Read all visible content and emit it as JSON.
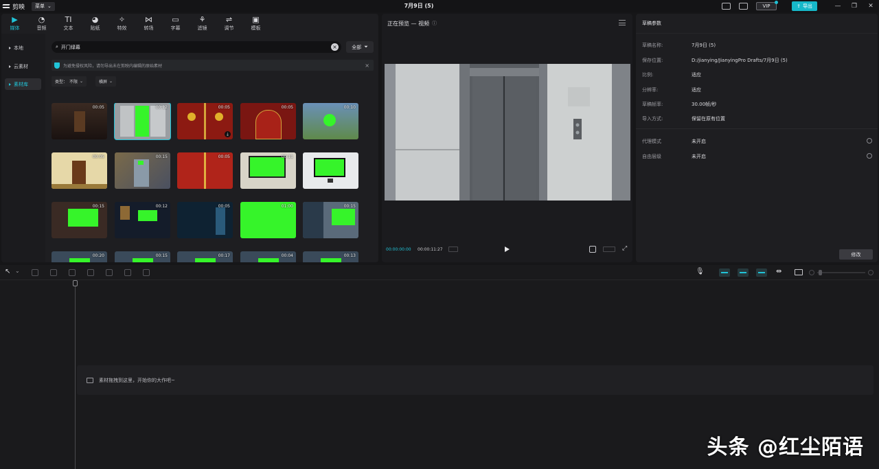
{
  "app": {
    "name": "剪映",
    "menu_label": "菜单",
    "title": "7月9日 (5)",
    "vip_label": "VIP",
    "export_label": "导出",
    "window_controls": [
      "minimize-icon",
      "restore-icon",
      "close-icon"
    ]
  },
  "toolbar": {
    "items": [
      {
        "label": "媒体",
        "icon": "media-icon",
        "active": true
      },
      {
        "label": "音频",
        "icon": "audio-icon"
      },
      {
        "label": "文本",
        "icon": "text-icon"
      },
      {
        "label": "贴纸",
        "icon": "sticker-icon"
      },
      {
        "label": "特效",
        "icon": "effect-icon"
      },
      {
        "label": "转场",
        "icon": "transition-icon"
      },
      {
        "label": "字幕",
        "icon": "subtitle-icon"
      },
      {
        "label": "滤镜",
        "icon": "filter-icon"
      },
      {
        "label": "调节",
        "icon": "adjust-icon"
      },
      {
        "label": "模板",
        "icon": "template-icon"
      }
    ]
  },
  "sidebar": {
    "items": [
      {
        "label": "本地"
      },
      {
        "label": "云素材"
      },
      {
        "label": "素材库",
        "active": true
      }
    ]
  },
  "search": {
    "value": "开门绿幕",
    "filter_label": "全部"
  },
  "notice": {
    "text": "为避免侵权风险，请勿导出未在剪映内编辑的原始素材"
  },
  "filters": {
    "type_label": "类型：",
    "type_value": "不限",
    "orientation_value": "横屏"
  },
  "library": {
    "thumbs": [
      {
        "dur": "00:05",
        "scene": "door-dark"
      },
      {
        "dur": "00:12",
        "scene": "elevator-green",
        "selected": true
      },
      {
        "dur": "00:05",
        "scene": "red-gate"
      },
      {
        "dur": "00:05",
        "scene": "red-door"
      },
      {
        "dur": "00:10",
        "scene": "outdoor-circle"
      },
      {
        "dur": "00:05",
        "scene": "wood-door"
      },
      {
        "dur": "00:15",
        "scene": "stone-door"
      },
      {
        "dur": "00:05",
        "scene": "red-gate-2"
      },
      {
        "dur": "00:11",
        "scene": "room-green"
      },
      {
        "dur": "",
        "scene": "monitor-green"
      },
      {
        "dur": "00:15",
        "scene": "room-tv"
      },
      {
        "dur": "00:12",
        "scene": "desk-night"
      },
      {
        "dur": "00:05",
        "scene": "blue-door"
      },
      {
        "dur": "01:00",
        "scene": "green-full"
      },
      {
        "dur": "00:15",
        "scene": "city-screen"
      },
      {
        "dur": "00:20",
        "scene": "partial"
      },
      {
        "dur": "00:15",
        "scene": "partial"
      },
      {
        "dur": "00:17",
        "scene": "partial"
      },
      {
        "dur": "00:04",
        "scene": "partial"
      },
      {
        "dur": "00:13",
        "scene": "partial"
      }
    ]
  },
  "preview": {
    "title": "正在预览 — 视频",
    "timecode_current": "00:00:00:00",
    "timecode_total": "00:00:11:27"
  },
  "props": {
    "title": "草稿参数",
    "rows": [
      {
        "label": "草稿名称:",
        "value": "7月9日 (5)"
      },
      {
        "label": "保存位置:",
        "value": "D:/jianying/JianyingPro Drafts/7月9日 (5)"
      },
      {
        "label": "比例:",
        "value": "适应"
      },
      {
        "label": "分辨率:",
        "value": "适应"
      },
      {
        "label": "草稿帧率:",
        "value": "30.00帧/秒"
      },
      {
        "label": "导入方式:",
        "value": "保留在原有位置"
      },
      {
        "label": "代理模式",
        "value": "未开启"
      },
      {
        "label": "自由层级",
        "value": "未开启"
      }
    ],
    "modify_label": "修改"
  },
  "timeline": {
    "hint": "素材拖拽到这里，开始你的大作吧~"
  },
  "watermark": "头条 @红尘陌语",
  "colors": {
    "accent": "#21c4d8",
    "green_screen": "#36f42a",
    "background": "#161618"
  }
}
